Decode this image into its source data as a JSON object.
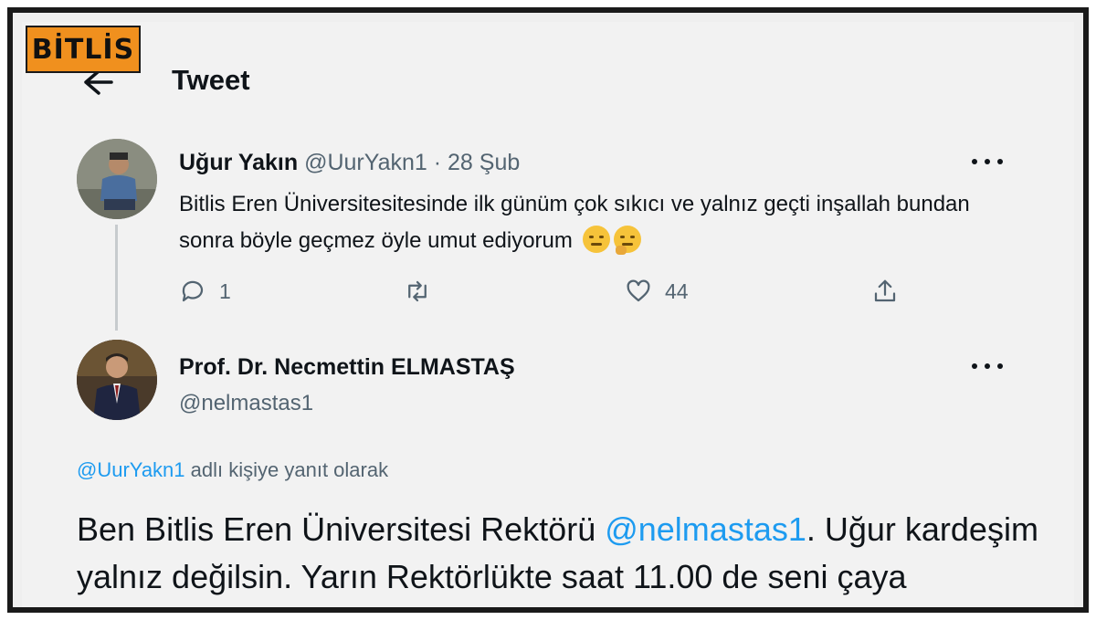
{
  "brand": {
    "label": "BİTLİS",
    "color": "#f0901e"
  },
  "header": {
    "title": "Tweet",
    "back_icon": "arrow-left-icon"
  },
  "tweet1": {
    "name": "Uğur Yakın",
    "handle": "@UurYakn1",
    "separator": "·",
    "date": "28 Şub",
    "text": "Bitlis Eren Üniversitesitesinde ilk günüm çok sıkıcı ve yalnız geçti inşallah bundan sonra böyle geçmez öyle umut ediyorum",
    "emojis": [
      "smirk-emoji",
      "thinking-emoji"
    ],
    "actions": {
      "reply_count": "1",
      "retweet_count": "",
      "like_count": "44"
    }
  },
  "tweet2": {
    "name": "Prof. Dr. Necmettin ELMASTAŞ",
    "handle": "@nelmastas1",
    "reply_mention": "@UurYakn1",
    "reply_suffix": "adlı kişiye yanıt olarak",
    "text_before": "Ben Bitlis Eren Üniversitesi Rektörü ",
    "text_mention": "@nelmastas1",
    "text_after": ". Uğur kardeşim yalnız değilsin. Yarın Rektörlükte saat 11.00 de seni çaya bekliyorum."
  },
  "colors": {
    "link": "#1d9bf0",
    "muted": "#536471",
    "text": "#0f1419"
  }
}
